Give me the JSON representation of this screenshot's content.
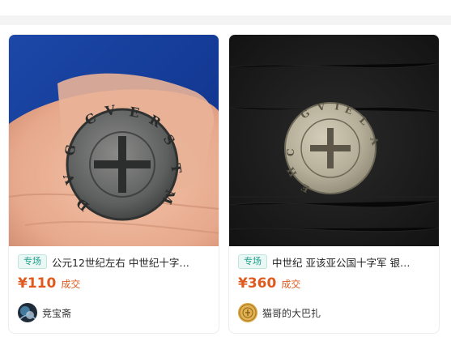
{
  "listings": [
    {
      "tag": "专场",
      "title": "公元12世纪左右 中世纪十字…",
      "price": "¥110",
      "status": "成交",
      "seller": "竞宝斋",
      "image_icon": "coin-in-hand-photo",
      "avatar_icon": "seller-avatar-dark"
    },
    {
      "tag": "专场",
      "title": "中世纪 亚该亚公国十字军 银…",
      "price": "¥360",
      "status": "成交",
      "seller": "猫哥的大巴扎",
      "image_icon": "silver-coin-photo",
      "avatar_icon": "seller-avatar-gold-coin"
    }
  ],
  "colors": {
    "price": "#e05a1f",
    "tag_text": "#1fa08a",
    "tag_bg": "#eaf7f4"
  }
}
